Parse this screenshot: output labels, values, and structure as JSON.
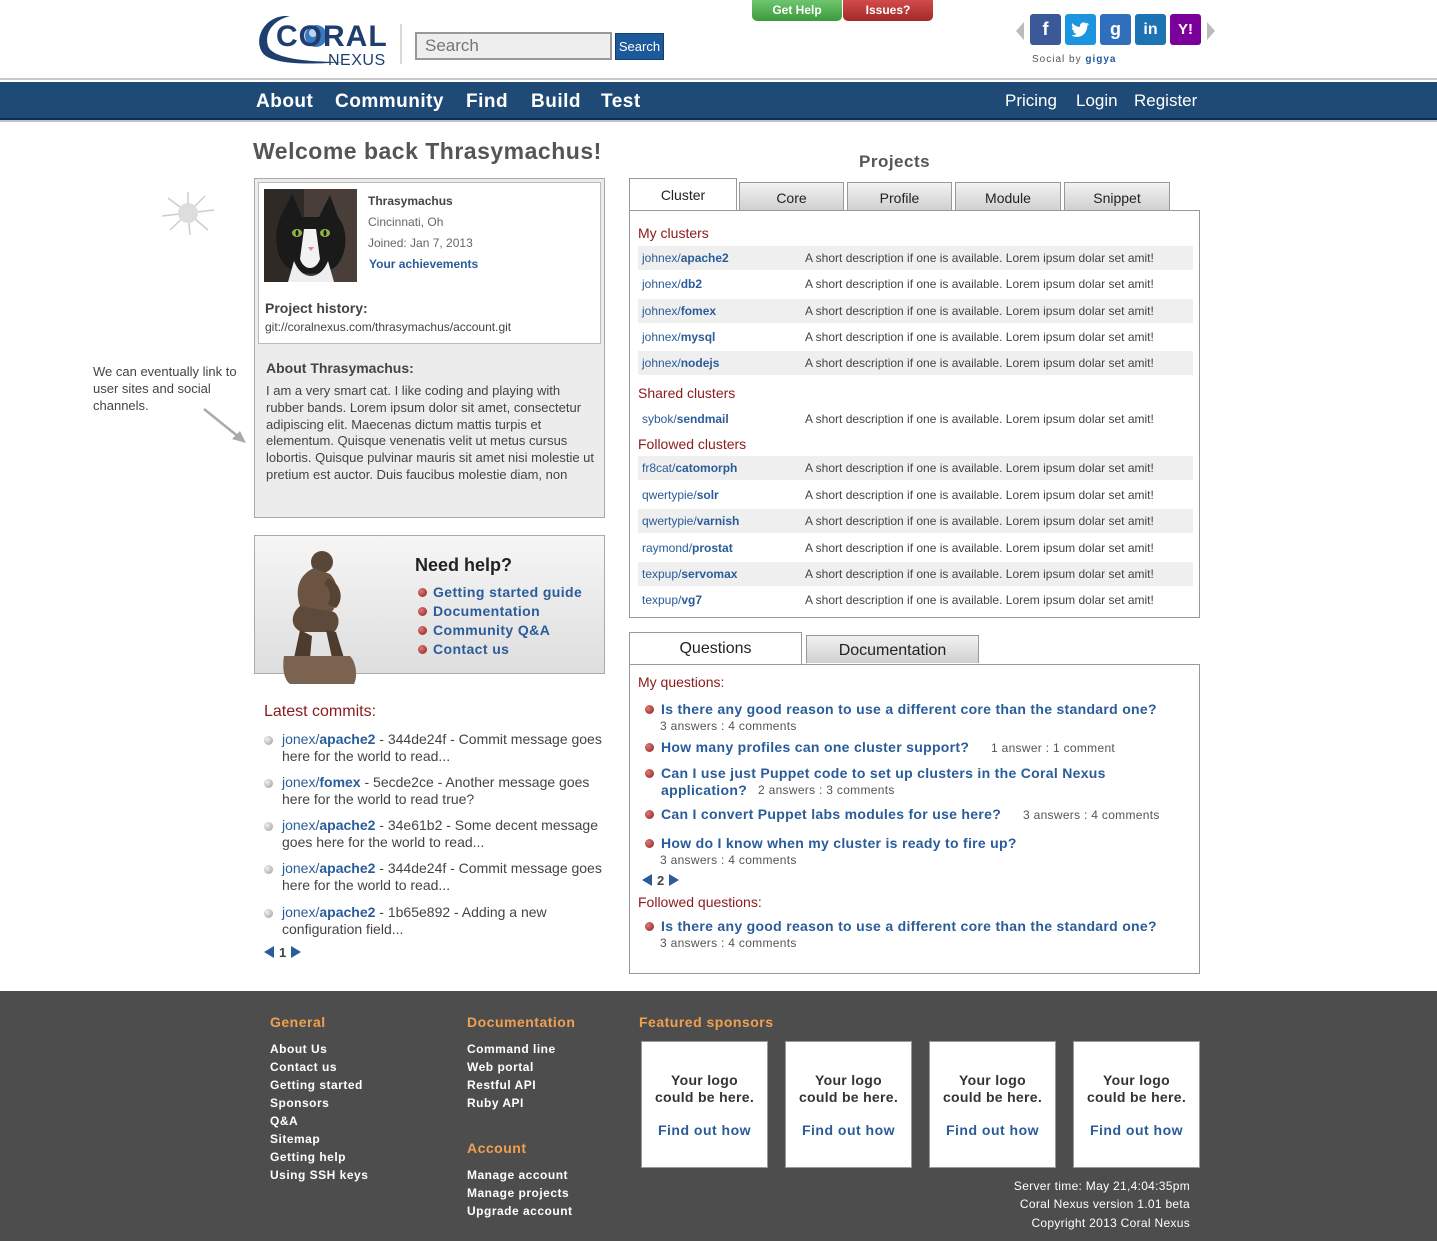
{
  "header": {
    "logo_main": "CORAL",
    "logo_sub": "NEXUS",
    "search_placeholder": "Search",
    "search_button": "Search",
    "help_tab": "Get Help",
    "issues_tab": "Issues?",
    "social_by": "Social by",
    "social_brand": "gigya",
    "social_icons": [
      "facebook-icon",
      "twitter-icon",
      "google-icon",
      "linkedin-icon",
      "yahoo-icon"
    ]
  },
  "nav": {
    "left": [
      "About",
      "Community",
      "Find",
      "Build",
      "Test"
    ],
    "right": [
      "Pricing",
      "Login",
      "Register"
    ]
  },
  "welcome": "Welcome back Thrasymachus!",
  "profile": {
    "name": "Thrasymachus",
    "city": "Cincinnati, Oh",
    "joined": "Joined: Jan 7, 2013",
    "achievements": "Your achievements",
    "history_label": "Project history:",
    "history_value": "git://coralnexus.com/thrasymachus/account.git",
    "about_label": "About Thrasymachus:",
    "about_text": "I am a very smart cat. I like coding and playing with rubber bands. Lorem ipsum dolor sit amet, consectetur adipiscing elit. Maecenas dictum mattis turpis et elementum. Quisque venenatis velit ut metus cursus lobortis. Quisque pulvinar mauris sit amet nisi molestie ut pretium est auctor. Duis faucibus molestie diam, non"
  },
  "note": "We can eventually link to user sites and social channels.",
  "help": {
    "title": "Need help?",
    "links": [
      "Getting started guide",
      "Documentation",
      "Community Q&A",
      "Contact us"
    ]
  },
  "commits": {
    "title": "Latest commits:",
    "items": [
      {
        "user": "jonex/",
        "repo": "apache2",
        "text": " - 344de24f - Commit message goes here for the world to read..."
      },
      {
        "user": "jonex/",
        "repo": "fomex",
        "text": " - 5ecde2ce - Another message goes here for the world to read true?"
      },
      {
        "user": "jonex/",
        "repo": "apache2",
        "text": " - 34e61b2 - Some decent message goes here for the world to read..."
      },
      {
        "user": "jonex/",
        "repo": "apache2",
        "text": " - 344de24f - Commit message goes here for the world to read..."
      },
      {
        "user": "jonex/",
        "repo": "apache2",
        "text": " - 1b65e892 - Adding a new configuration field..."
      }
    ],
    "page": "1"
  },
  "projects": {
    "title": "Projects",
    "tabs": [
      "Cluster",
      "Core",
      "Profile",
      "Module",
      "Snippet"
    ],
    "my_title": "My clusters",
    "my": [
      {
        "user": "johnex/",
        "repo": "apache2",
        "desc": "A short description if one is available. Lorem ipsum dolar set amit!"
      },
      {
        "user": "johnex/",
        "repo": "db2",
        "desc": "A short description if one is available. Lorem ipsum dolar set amit!"
      },
      {
        "user": "johnex/",
        "repo": "fomex",
        "desc": "A short description if one is available. Lorem ipsum dolar set amit!"
      },
      {
        "user": "johnex/",
        "repo": "mysql",
        "desc": "A short description if one is available. Lorem ipsum dolar set amit!"
      },
      {
        "user": "johnex/",
        "repo": "nodejs",
        "desc": "A short description if one is available. Lorem ipsum dolar set amit!"
      }
    ],
    "shared_title": "Shared clusters",
    "shared": [
      {
        "user": "sybok/",
        "repo": "sendmail",
        "desc": "A short description if one is available. Lorem ipsum dolar set amit!"
      }
    ],
    "followed_title": "Followed clusters",
    "followed": [
      {
        "user": "fr8cat/",
        "repo": "catomorph",
        "desc": "A short description if one is available. Lorem ipsum dolar set amit!"
      },
      {
        "user": "qwertypie/",
        "repo": "solr",
        "desc": "A short description if one is available. Lorem ipsum dolar set amit!"
      },
      {
        "user": "qwertypie/",
        "repo": "varnish",
        "desc": "A short description if one is available. Lorem ipsum dolar set amit!"
      },
      {
        "user": "raymond/",
        "repo": "prostat",
        "desc": "A short description if one is available. Lorem ipsum dolar set amit!"
      },
      {
        "user": "texpup/",
        "repo": "servomax",
        "desc": "A short description if one is available. Lorem ipsum dolar set amit!"
      },
      {
        "user": "texpup/",
        "repo": "vg7",
        "desc": "A short description if one is available. Lorem ipsum dolar set amit!"
      }
    ]
  },
  "questions": {
    "tabs": [
      "Questions",
      "Documentation"
    ],
    "my_title": "My questions:",
    "my": [
      {
        "q": "Is there any good reason to use a different core than the standard one?",
        "meta": "3 answers : 4 comments"
      },
      {
        "q": "How many profiles can one cluster support?",
        "meta": "1 answer : 1 comment"
      },
      {
        "q": "Can I use just Puppet code to set up clusters in the Coral Nexus",
        "q2": "application?",
        "meta": "2 answers : 3 comments"
      },
      {
        "q": "Can I convert Puppet labs modules for use here?",
        "meta": "3 answers : 4 comments"
      },
      {
        "q": "How do I know when my cluster is ready to fire up?",
        "meta": "3 answers : 4 comments"
      }
    ],
    "page": "2",
    "followed_title": "Followed questions:",
    "followed": [
      {
        "q": "Is there any good reason to use a different core than the standard one?",
        "meta": "3 answers : 4 comments"
      }
    ]
  },
  "footer": {
    "general_title": "General",
    "general": [
      "About Us",
      "Contact us",
      "Getting started",
      "Sponsors",
      "Q&A",
      "Sitemap",
      "Getting help",
      "Using SSH keys"
    ],
    "docs_title": "Documentation",
    "docs": [
      "Command line",
      "Web portal",
      "Restful API",
      "Ruby API"
    ],
    "account_title": "Account",
    "account": [
      "Manage account",
      "Manage projects",
      "Upgrade account"
    ],
    "sponsors_title": "Featured sponsors",
    "sponsor_text_1": "Your logo",
    "sponsor_text_2": "could be here.",
    "sponsor_link": "Find out how",
    "server_time": "Server time: May 21,4:04:35pm",
    "version": "Coral Nexus version 1.01 beta",
    "copyright": "Copyright 2013 Coral Nexus"
  },
  "colors": {
    "nav": "#204a76",
    "link": "#2a5c9a",
    "section_title": "#8b1a1a",
    "footer_bg": "#4d4d4d",
    "footer_heading": "#f0a050"
  }
}
